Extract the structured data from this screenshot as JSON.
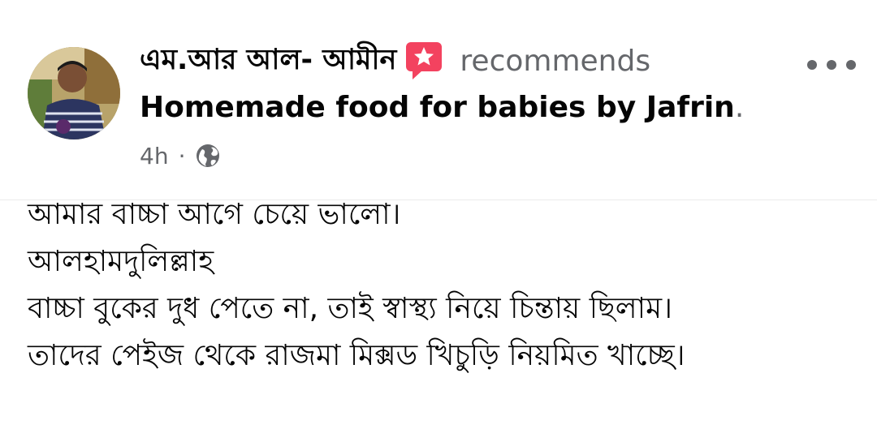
{
  "post": {
    "author": "এম.আর আল- আমীন",
    "action": "recommends",
    "page_name": "Homemade food for babies by Jafrin",
    "page_name_suffix": ".",
    "time": "4h",
    "separator": "·",
    "audience_icon": "globe-icon",
    "recommend_icon": "recommend-star-icon",
    "more_icon": "more-options-icon",
    "lines": [
      "আমার বাচ্চা আগে চেয়ে ভালো।",
      "আলহামদুলিল্লাহ",
      "বাচ্চা বুকের দুধ পেতে না, তাই স্বাস্থ্য নিয়ে চিন্তায় ছিলাম।",
      "তাদের পেইজ থেকে রাজমা মিক্সড খিচুড়ি নিয়মিত খাচ্ছে।"
    ]
  },
  "colors": {
    "recommend_red": "#f3425f",
    "meta_gray": "#65676b",
    "text": "#050505"
  }
}
